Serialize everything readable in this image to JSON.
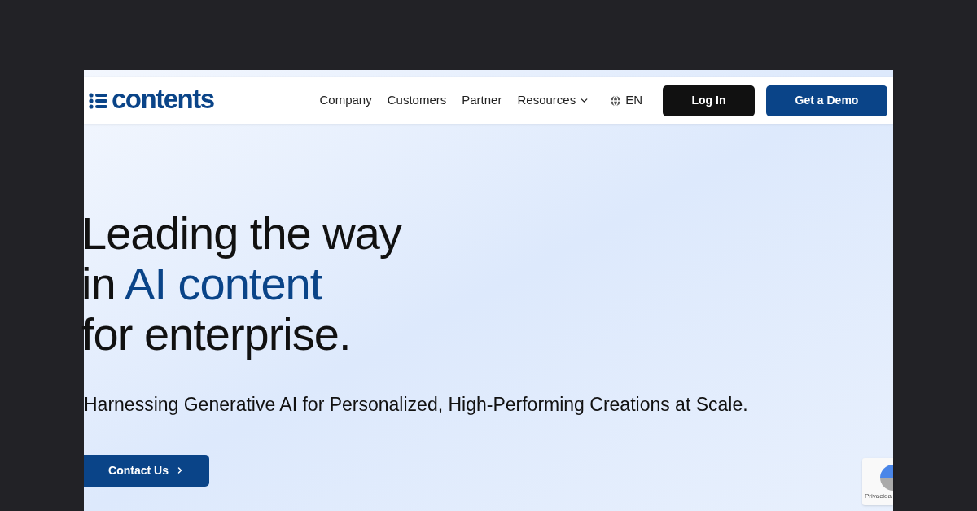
{
  "logo": {
    "text": "contents"
  },
  "nav": {
    "items": [
      {
        "label": "Company",
        "dropdown": false
      },
      {
        "label": "Customers",
        "dropdown": false
      },
      {
        "label": "Partner",
        "dropdown": false
      },
      {
        "label": "Resources",
        "dropdown": true
      }
    ],
    "language": "EN",
    "login": "Log In",
    "demo": "Get a Demo"
  },
  "hero": {
    "title_lines": [
      {
        "segments": [
          {
            "text": "Leading the way",
            "accent": false
          }
        ]
      },
      {
        "segments": [
          {
            "text": "in ",
            "accent": false
          },
          {
            "text": "AI content",
            "accent": true
          }
        ]
      },
      {
        "segments": [
          {
            "text": "for enterprise.",
            "accent": false
          }
        ]
      }
    ],
    "subtitle": "Harnessing Generative AI for Personalized, High-Performing Creations at Scale.",
    "cta": "Contact Us"
  },
  "recaptcha": {
    "text": "Privacida"
  }
}
